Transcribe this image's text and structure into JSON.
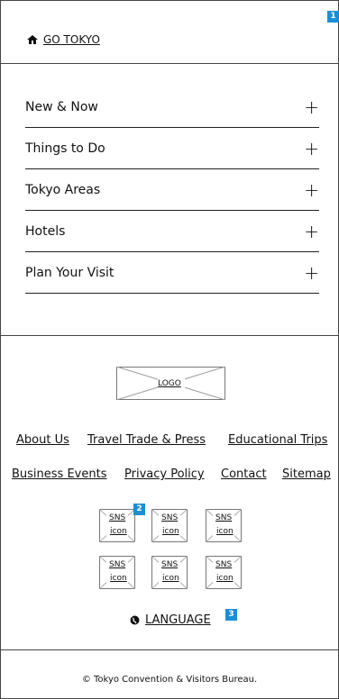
{
  "header": {
    "home_label": "GO TOKYO"
  },
  "nav": {
    "items": [
      {
        "label": "New & Now"
      },
      {
        "label": "Things to Do"
      },
      {
        "label": "Tokyo Areas"
      },
      {
        "label": "Hotels"
      },
      {
        "label": "Plan Your Visit"
      }
    ],
    "expand_symbol": "+"
  },
  "logo": {
    "label": "LOGO"
  },
  "links_row1": [
    "About Us",
    "Travel Trade & Press",
    "Educational Trips"
  ],
  "links_row2": [
    "Business Events",
    "Privacy Policy",
    "Contact",
    "Sitemap"
  ],
  "sns": {
    "label_top": "SNS",
    "label_bottom": "icon"
  },
  "language": {
    "label": "LANGUAGE"
  },
  "footer": {
    "copyright": "© Tokyo Convention & Visitors Bureau."
  },
  "badges": {
    "b1": "1",
    "b2": "2",
    "b3": "3"
  },
  "colors": {
    "badge": "#1a8fd6",
    "line": "#222222"
  }
}
